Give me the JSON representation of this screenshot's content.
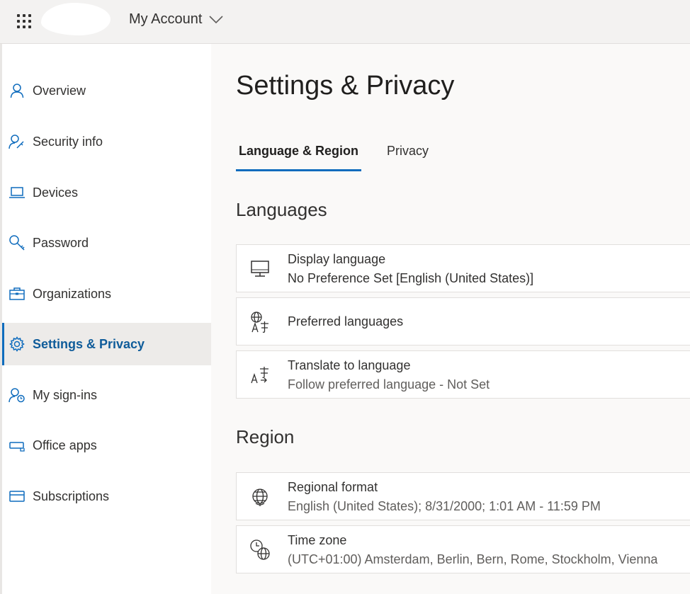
{
  "header": {
    "app_title": "My Account",
    "waffle_icon": "waffle-icon",
    "chevron_icon": "chevron-down-icon"
  },
  "sidebar": {
    "items": [
      {
        "label": "Overview",
        "icon": "person-icon",
        "active": false
      },
      {
        "label": "Security info",
        "icon": "person-key-icon",
        "active": false
      },
      {
        "label": "Devices",
        "icon": "laptop-icon",
        "active": false
      },
      {
        "label": "Password",
        "icon": "key-icon",
        "active": false
      },
      {
        "label": "Organizations",
        "icon": "briefcase-icon",
        "active": false
      },
      {
        "label": "Settings & Privacy",
        "icon": "gear-icon",
        "active": true
      },
      {
        "label": "My sign-ins",
        "icon": "person-sync-icon",
        "active": false
      },
      {
        "label": "Office apps",
        "icon": "apps-icon",
        "active": false
      },
      {
        "label": "Subscriptions",
        "icon": "card-icon",
        "active": false
      }
    ]
  },
  "main": {
    "title": "Settings & Privacy",
    "tabs": [
      {
        "label": "Language & Region",
        "active": true
      },
      {
        "label": "Privacy",
        "active": false
      }
    ],
    "languages": {
      "heading": "Languages",
      "cards": [
        {
          "title": "Display language",
          "value": "No Preference Set [English (United States)]",
          "icon": "monitor-icon"
        },
        {
          "title": "Preferred languages",
          "value": "",
          "icon": "globe-translate-icon"
        },
        {
          "title": "Translate to language",
          "value": "Follow preferred language - Not Set",
          "icon": "translate-icon"
        }
      ]
    },
    "region": {
      "heading": "Region",
      "cards": [
        {
          "title": "Regional format",
          "value": "English (United States); 8/31/2000; 1:01 AM - 11:59 PM",
          "icon": "globe-grid-icon"
        },
        {
          "title": "Time zone",
          "value": "(UTC+01:00) Amsterdam, Berlin, Bern, Rome, Stockholm, Vienna",
          "icon": "clock-globe-icon"
        }
      ]
    }
  },
  "colors": {
    "accent": "#0f6cbd",
    "active_text": "#0f5c9a",
    "active_bg": "#edebe9",
    "page_bg": "#faf9f8"
  }
}
